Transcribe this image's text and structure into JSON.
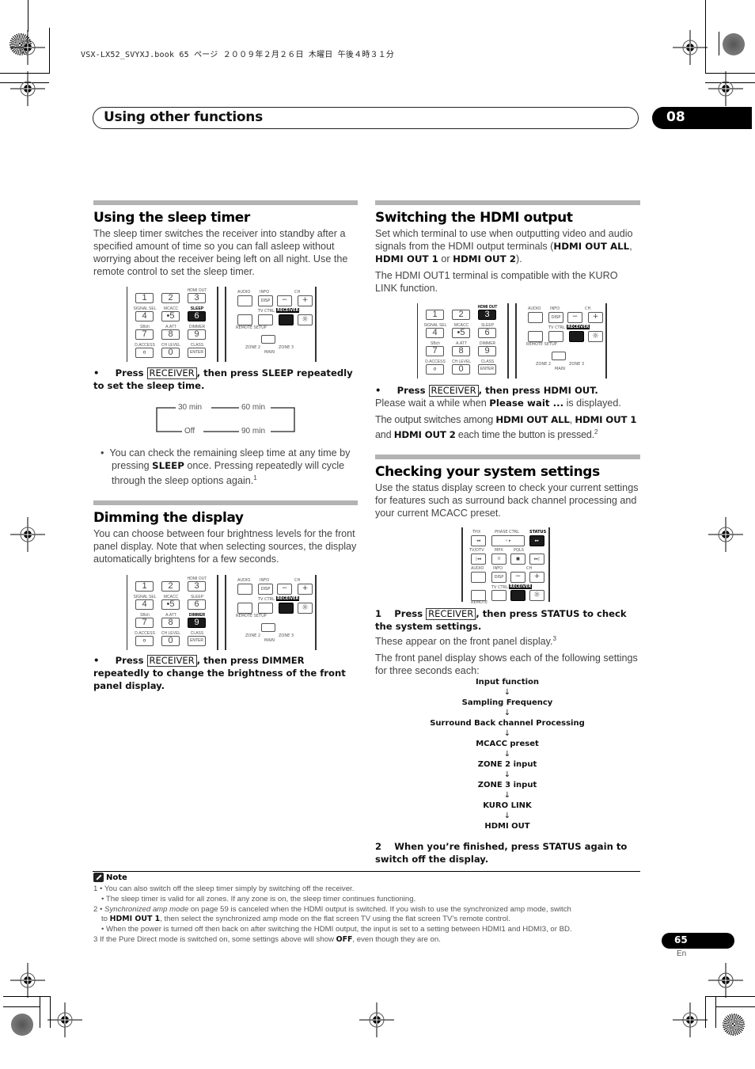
{
  "print_meta": {
    "file_line": "VSX-LX52_SVYXJ.book  65 ページ  ２００９年２月２６日  木曜日  午後４時３１分"
  },
  "header": {
    "title": "Using other functions",
    "chapter": "08"
  },
  "sleep_timer": {
    "heading": "Using the sleep timer",
    "intro": "The sleep timer switches the receiver into standby after a specified amount of time so you can fall asleep without worrying about the receiver being left on all night. Use the remote control to set the sleep timer.",
    "step": {
      "bullet": "•",
      "press": "Press",
      "key": "RECEIVER",
      "rest": ", then press SLEEP repeatedly to set the sleep time."
    },
    "cycle": [
      "30 min",
      "60 min",
      "90 min",
      "Off"
    ],
    "tip": {
      "pre": "You can check the remaining sleep time at any time by pressing ",
      "key": "SLEEP",
      "post": " once. Pressing repeatedly will cycle through the sleep options again.",
      "footnote": "1"
    },
    "remote_highlight": "SLEEP"
  },
  "dimming": {
    "heading": "Dimming the display",
    "intro": "You can choose between four brightness levels for the front panel display. Note that when selecting sources, the display automatically brightens for a few seconds.",
    "step": {
      "bullet": "•",
      "press": "Press",
      "key": "RECEIVER",
      "rest": ", then press DIMMER repeatedly to change the brightness of the front panel display."
    },
    "remote_highlight": "DIMMER"
  },
  "hdmi": {
    "heading": "Switching the HDMI output",
    "intro_pre": "Set which terminal to use when outputting video and audio signals from the HDMI output terminals (",
    "opt_all": "HDMI OUT ALL",
    "sep1": ", ",
    "opt_1": "HDMI OUT 1",
    "sep2": " or ",
    "opt_2": "HDMI OUT 2",
    "intro_post": ").",
    "kuro": "The HDMI OUT1 terminal is compatible with the KURO LINK function.",
    "step": {
      "bullet": "•",
      "press": "Press",
      "key": "RECEIVER",
      "rest": ", then press HDMI OUT."
    },
    "wait_pre": "Please wait a while when ",
    "wait_key": "Please wait ...",
    "wait_post": " is displayed.",
    "switch_pre": "The output switches among ",
    "switch_post_1": ", ",
    "switch_mid": " and ",
    "switch_post": " each time the button is pressed.",
    "footnote": "2",
    "remote_highlight": "HDMI OUT"
  },
  "system": {
    "heading": "Checking your system settings",
    "intro": "Use the status display screen to check your current settings for features such as surround back channel processing and your current MCACC preset.",
    "step1": {
      "num": "1",
      "press": "Press",
      "key": "RECEIVER",
      "rest": ", then press STATUS to check the system settings."
    },
    "appear": "These appear on the front panel display.",
    "appear_fn": "3",
    "shows": "The front panel display shows each of the following settings for three seconds each:",
    "flow": [
      "Input function",
      "Sampling Frequency",
      "Surround Back channel Processing",
      "MCACC preset",
      "ZONE 2 input",
      "ZONE 3 input",
      "KURO LINK",
      "HDMI OUT"
    ],
    "arrow": "↓",
    "step2": {
      "num": "2",
      "text": "When you’re finished, press STATUS again to switch off the display."
    },
    "remote_highlight": "STATUS"
  },
  "remote": {
    "numkeys": [
      "1",
      "2",
      "3",
      "4",
      "•5",
      "6",
      "7",
      "8",
      "9",
      "∘",
      "0",
      "ENTER"
    ],
    "numlabels_top": [
      "",
      "",
      "HDMI OUT"
    ],
    "numlabels_row2": [
      "SIGNAL SEL",
      "MCACC",
      "SLEEP"
    ],
    "numlabels_row3": [
      "SBch",
      "A.ATT",
      "DIMMER"
    ],
    "numlabels_row4": [
      "D.ACCESS",
      "CH LEVEL",
      "CLASS"
    ],
    "right": {
      "audio": "AUDIO",
      "info": "INFO",
      "disp": "DISP",
      "ch": "CH",
      "minus": "−",
      "plus": "+",
      "tvctrl": "TV CTRL",
      "receiver": "RECEIVER",
      "remote_setup": "REMOTE SETUP",
      "zone2": "ZONE 2",
      "zone3": "ZONE 3",
      "main": "MAIN",
      "light": "☼"
    },
    "status_panel": {
      "thx": "THX",
      "phase": "PHASE CTRL",
      "status": "STATUS",
      "tvdtv": "TV/DTV",
      "mpx": "MPX",
      "pqls": "PQLS",
      "k_rew": "◂◂",
      "k_play": "∘ ▸",
      "k_ff": "▸▸",
      "k_prev": "|◂◂",
      "k_pause": "II",
      "k_stop": "■",
      "k_next": "▸▸|",
      "remote": "REMOTE"
    }
  },
  "notes": {
    "heading": "Note",
    "lines": [
      {
        "num": "1",
        "text": "• You can also switch off the sleep timer simply by switching off the receiver."
      },
      {
        "num": "",
        "text": "• The sleep timer is valid for all zones. If any zone is on, the sleep timer continues functioning."
      },
      {
        "num": "2",
        "italic": "Synchronized amp mode",
        "text": " on page 59 is canceled when the HDMI output is switched. If you wish to use the synchronized amp mode, switch"
      },
      {
        "num": "",
        "pre": "to ",
        "bold": "HDMI OUT 1",
        "text": ", then select the synchronized amp mode on the flat screen TV using the flat screen TV’s remote control."
      },
      {
        "num": "",
        "text": "• When the power is turned off then back on after switching the HDMI output, the input is set to a setting between HDMI1 and HDMI3, or BD."
      },
      {
        "num": "3",
        "pre": "If the Pure Direct mode is switched on, some settings above will show ",
        "bold": "OFF",
        "text": ", even though they are on."
      }
    ]
  },
  "footer": {
    "page": "65",
    "lang": "En"
  }
}
